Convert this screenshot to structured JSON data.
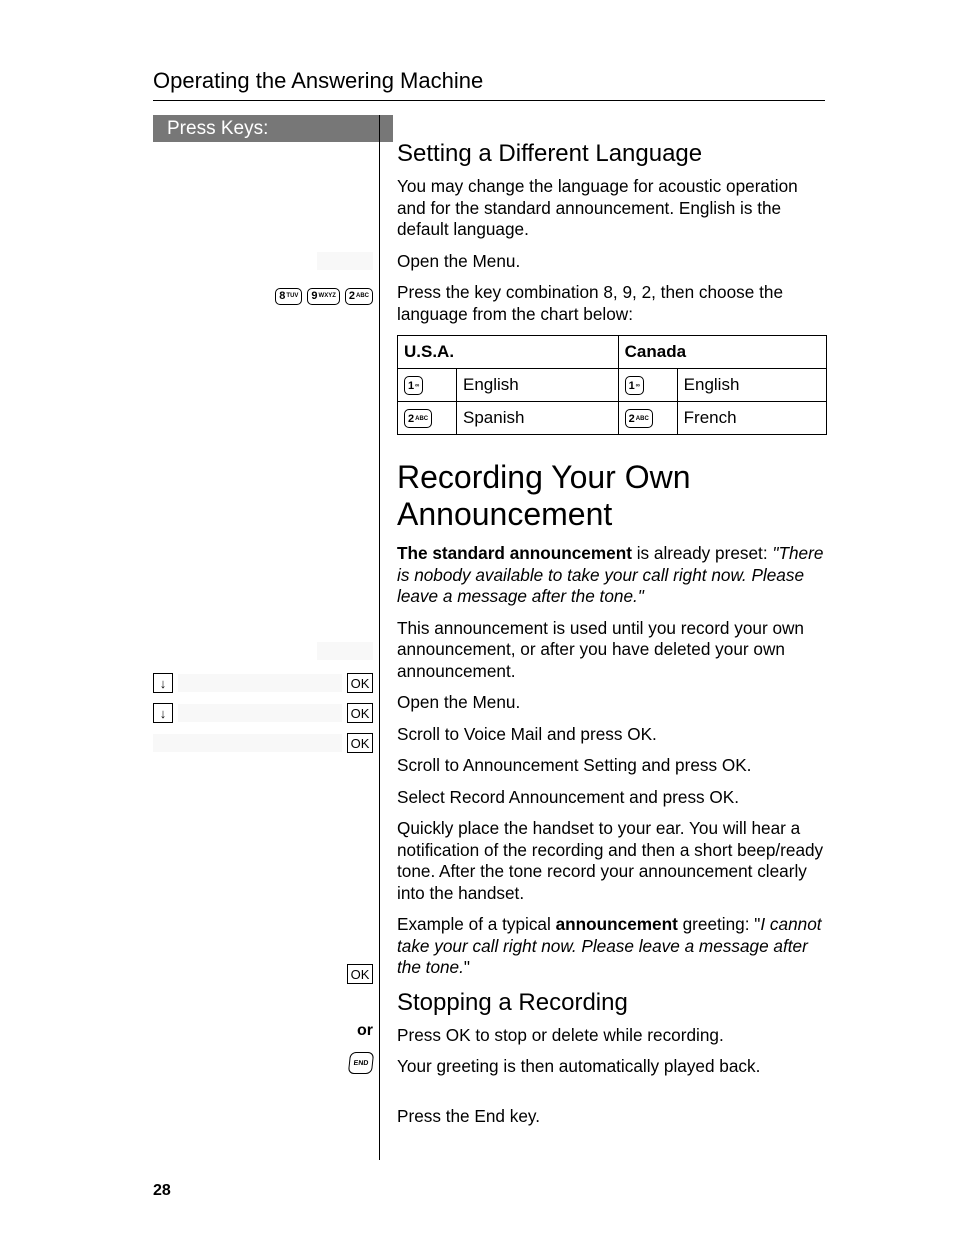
{
  "header": {
    "title": "Operating the Answering Machine"
  },
  "sidebar": {
    "title": "Press Keys:",
    "keyseq": [
      {
        "num": "8",
        "sub": "TUV"
      },
      {
        "num": "9",
        "sub": "WXYZ"
      },
      {
        "num": "2",
        "sub": "ABC"
      }
    ],
    "ok": "OK",
    "or": "or",
    "end": "END"
  },
  "section1": {
    "heading": "Setting a Different Language",
    "p1": "You may change the language for acoustic operation and for the standard announcement. English is the default language.",
    "p2": "Open the Menu.",
    "p3": "Press the key combination 8, 9, 2, then choose the language from the chart below:"
  },
  "table": {
    "h1": "U.S.A.",
    "h2": "Canada",
    "rows": [
      {
        "k1": {
          "num": "1",
          "sub": ""
        },
        "v1": "English",
        "k2": {
          "num": "1",
          "sub": ""
        },
        "v2": "English"
      },
      {
        "k1": {
          "num": "2",
          "sub": "ABC"
        },
        "v1": "Spanish",
        "k2": {
          "num": "2",
          "sub": "ABC"
        },
        "v2": "French"
      }
    ]
  },
  "section2": {
    "heading": "Recording Your Own Announcement",
    "p1a": "The standard announcement",
    "p1b": " is already preset: ",
    "p1c": "\"There is nobody available to take your call right now. Please leave a message after the tone.\"",
    "p2": "This announcement is used until you record your own announcement, or after you have deleted your own announcement.",
    "p3": "Open the Menu.",
    "p4": "Scroll to Voice Mail and press OK.",
    "p5": "Scroll to Announcement Setting and press OK.",
    "p6": "Select Record Announcement and press OK.",
    "p7": "Quickly place the handset to your ear.  You  will hear a notification of the recording and then a short beep/ready tone.  After the tone record your announcement clearly into the handset.",
    "p8a": "Example of a typical ",
    "p8b": "announcement",
    "p8c": " greeting: \"",
    "p8d": "I cannot take your call right now. Please leave a message after the tone.",
    "p8e": "\""
  },
  "section3": {
    "heading": "Stopping a Recording",
    "p1": "Press OK to stop or delete while recording.",
    "p2": "Your greeting is then automatically played back.",
    "p3": "Press the End key."
  },
  "pageNumber": "28"
}
